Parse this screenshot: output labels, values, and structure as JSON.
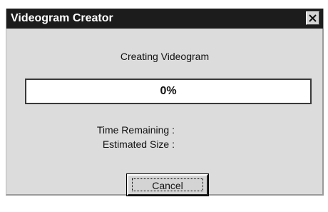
{
  "window": {
    "title": "Videogram Creator",
    "close_icon": "close-x-icon"
  },
  "status": {
    "message": "Creating Videogram"
  },
  "progress": {
    "percent_label": "0%",
    "fraction": 0.0
  },
  "info": {
    "time_remaining_label": "Time Remaining :",
    "estimated_size_label": "Estimated Size :"
  },
  "buttons": {
    "cancel_label": "Cancel"
  },
  "colors": {
    "titlebar": "#1c1c1c",
    "dialog_background": "#dcdcdc",
    "progress_fill": "#000080"
  }
}
